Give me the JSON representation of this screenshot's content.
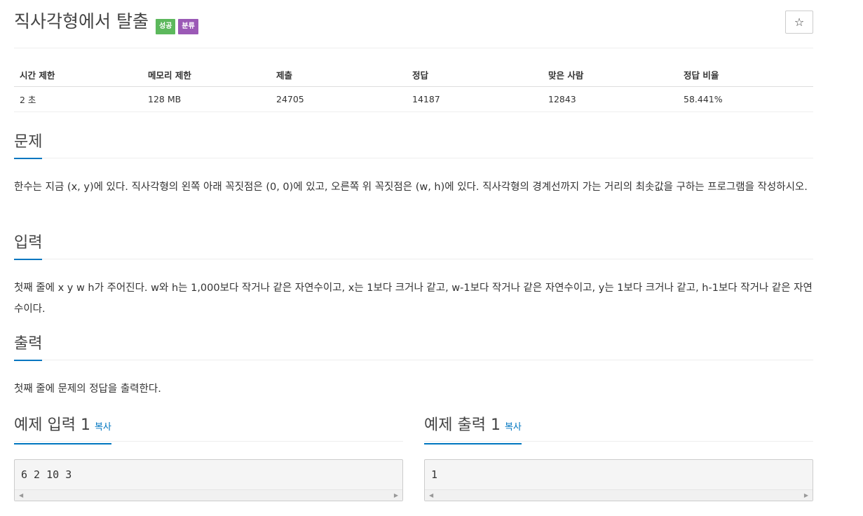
{
  "problem": {
    "title": "직사각형에서 탈출",
    "badges": {
      "success": "성공",
      "category": "분류"
    },
    "star_icon": "☆"
  },
  "info_table": {
    "headers": [
      "시간 제한",
      "메모리 제한",
      "제출",
      "정답",
      "맞은 사람",
      "정답 비율"
    ],
    "values": [
      "2 초",
      "128 MB",
      "24705",
      "14187",
      "12843",
      "58.441%"
    ]
  },
  "sections": {
    "problem": {
      "heading": "문제",
      "text": "한수는 지금 (x, y)에 있다. 직사각형의 왼쪽 아래 꼭짓점은 (0, 0)에 있고, 오른쪽 위 꼭짓점은 (w, h)에 있다. 직사각형의 경계선까지 가는 거리의 최솟값을 구하는 프로그램을 작성하시오."
    },
    "input": {
      "heading": "입력",
      "text": "첫째 줄에 x y w h가 주어진다. w와 h는 1,000보다 작거나 같은 자연수이고, x는 1보다 크거나 같고, w-1보다 작거나 같은 자연수이고, y는 1보다 크거나 같고, h-1보다 작거나 같은 자연수이다."
    },
    "output": {
      "heading": "출력",
      "text": "첫째 줄에 문제의 정답을 출력한다."
    }
  },
  "samples": {
    "input": {
      "heading": "예제 입력 1",
      "copy": "복사",
      "content": "6 2 10 3"
    },
    "output": {
      "heading": "예제 출력 1",
      "copy": "복사",
      "content": "1"
    }
  },
  "colors": {
    "accent": "#0076c0",
    "success_badge": "#5cb85c",
    "category_badge": "#9b59b6"
  }
}
